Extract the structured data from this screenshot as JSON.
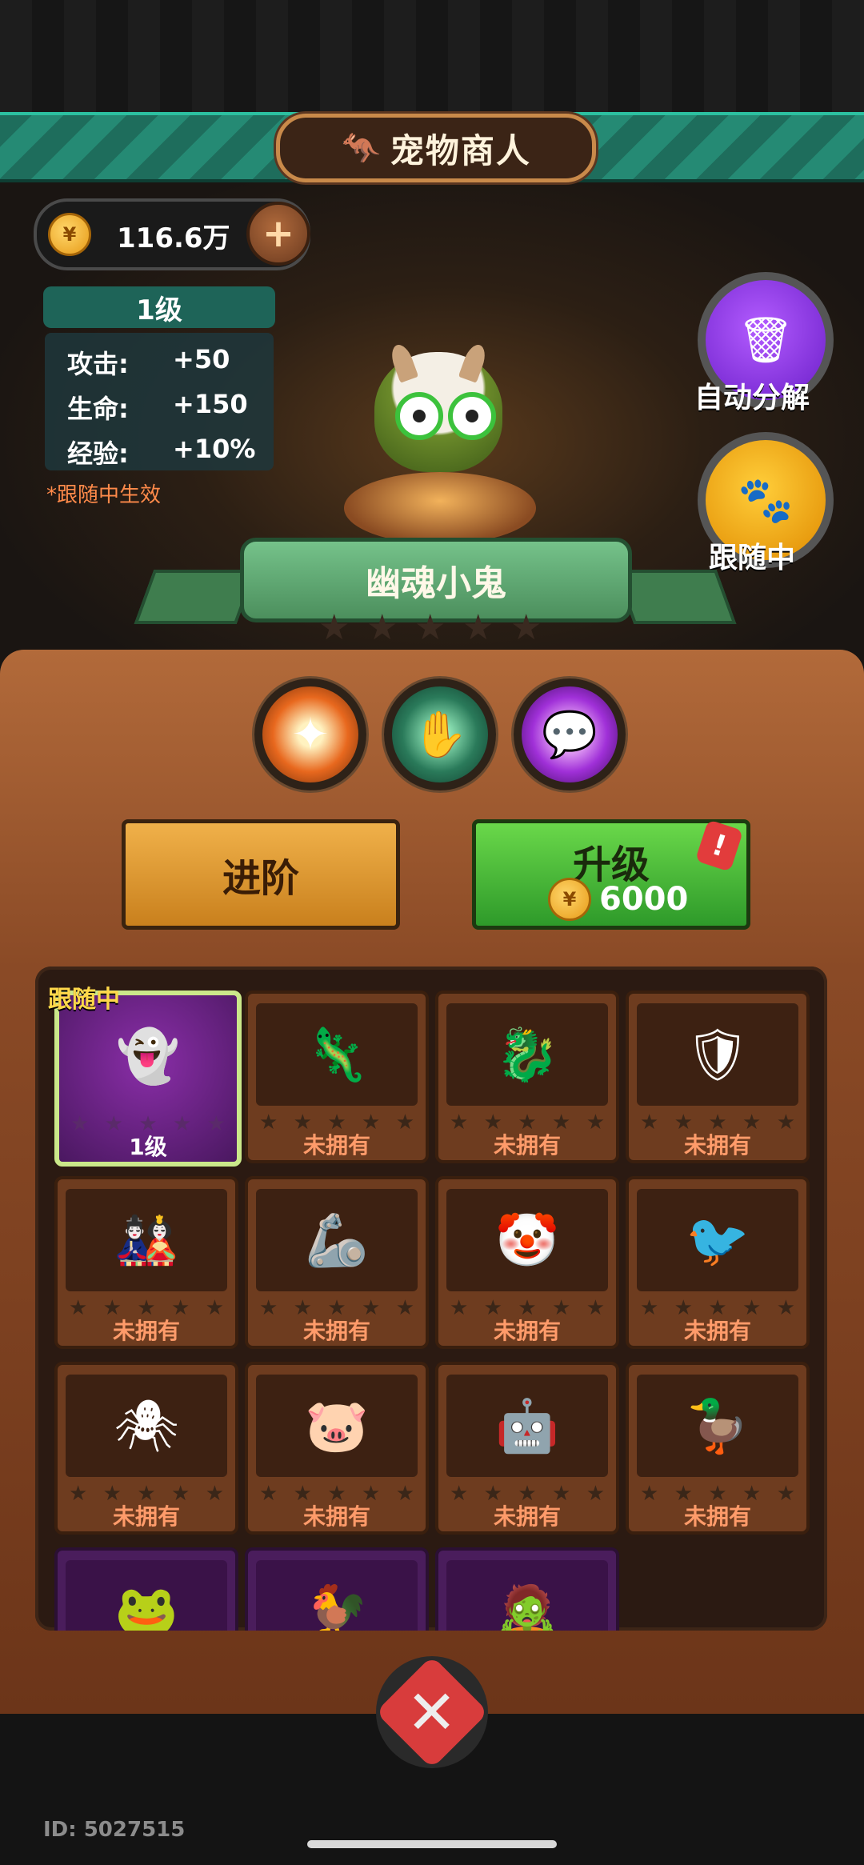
{
  "header": {
    "title": "宠物商人",
    "title_icon": "kangaroo-icon"
  },
  "currency": {
    "amount": "116.6万",
    "icon": "coin-icon",
    "add_icon": "plus-icon"
  },
  "stats": {
    "level": "1级",
    "rows": [
      {
        "key": "攻击:",
        "value": "+50"
      },
      {
        "key": "生命:",
        "value": "+150"
      },
      {
        "key": "经验:",
        "value": "+10%"
      }
    ],
    "note": "*跟随中生效"
  },
  "side_buttons": {
    "auto_decompose": "自动分解",
    "following": "跟随中"
  },
  "pet": {
    "name": "幽魂小鬼",
    "stars": 5
  },
  "skills": [
    {
      "icon": "sparkle-icon",
      "color": "#e8681e"
    },
    {
      "icon": "claw-icon",
      "color": "#2a7a5a"
    },
    {
      "icon": "speech-bubble-icon",
      "color": "#a030d8"
    }
  ],
  "actions": {
    "advance": "进阶",
    "upgrade": "升级",
    "upgrade_cost": "6000",
    "alert": "!"
  },
  "grid": {
    "following_tag": "跟随中",
    "cards": [
      {
        "label": "1级",
        "glyph": "👻",
        "state": "active"
      },
      {
        "label": "未拥有",
        "glyph": "🦎",
        "state": "locked"
      },
      {
        "label": "未拥有",
        "glyph": "🐉",
        "state": "locked"
      },
      {
        "label": "未拥有",
        "glyph": "🛡",
        "state": "locked"
      },
      {
        "label": "未拥有",
        "glyph": "🎎",
        "state": "locked"
      },
      {
        "label": "未拥有",
        "glyph": "🦾",
        "state": "locked"
      },
      {
        "label": "未拥有",
        "glyph": "🤡",
        "state": "locked"
      },
      {
        "label": "未拥有",
        "glyph": "🐦",
        "state": "locked"
      },
      {
        "label": "未拥有",
        "glyph": "🕷",
        "state": "locked"
      },
      {
        "label": "未拥有",
        "glyph": "🐷",
        "state": "locked"
      },
      {
        "label": "未拥有",
        "glyph": "🤖",
        "state": "locked"
      },
      {
        "label": "未拥有",
        "glyph": "🦆",
        "state": "locked"
      },
      {
        "label": "",
        "glyph": "🐸",
        "state": "purple"
      },
      {
        "label": "",
        "glyph": "🐓",
        "state": "purple"
      },
      {
        "label": "",
        "glyph": "🧟",
        "state": "purple"
      }
    ]
  },
  "footer": {
    "id_text": "ID: 5027515",
    "close_glyph": "✕"
  }
}
